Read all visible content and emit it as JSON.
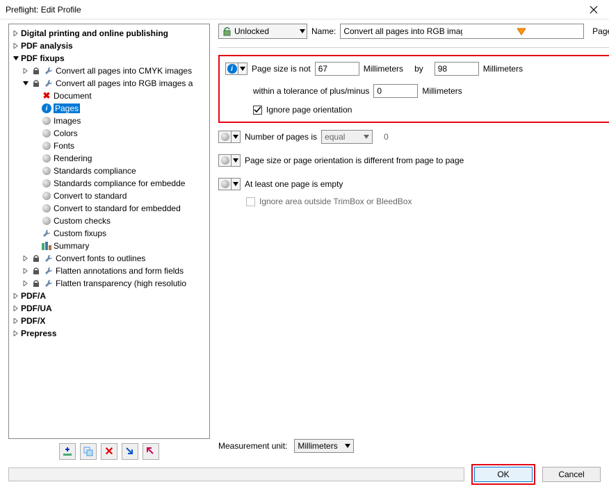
{
  "title": "Preflight: Edit Profile",
  "tree": {
    "top": [
      "Digital printing and online publishing",
      "PDF analysis",
      "PDF fixups"
    ],
    "fixups": {
      "cmyk": "Convert all pages into CMYK images",
      "rgb": "Convert all pages into RGB images a",
      "children": [
        "Document",
        "Pages",
        "Images",
        "Colors",
        "Fonts",
        "Rendering",
        "Standards compliance",
        "Standards compliance for embedde",
        "Convert to standard",
        "Convert to standard for embedded",
        "Custom checks",
        "Custom fixups",
        "Summary"
      ],
      "after": [
        "Convert fonts to outlines",
        "Flatten annotations and form fields",
        "Flatten transparency (high resolutio"
      ]
    },
    "bottom": [
      "PDF/A",
      "PDF/UA",
      "PDF/X",
      "Prepress"
    ]
  },
  "top": {
    "unlocked": "Unlocked",
    "name_label": "Name:",
    "name_value": "Convert all pages into RGB images and preserve text informa",
    "pages_label": "Pages"
  },
  "s1": {
    "label1": "Page size is not",
    "val1": "67",
    "unit": "Millimeters",
    "by": "by",
    "val2": "98",
    "tol_label": "within a tolerance of plus/minus",
    "tol_val": "0",
    "ignore": "Ignore page orientation"
  },
  "s2": {
    "label": "Number of pages is",
    "op": "equal",
    "val": "0"
  },
  "s3": {
    "label": "Page size or page orientation is different from page to page"
  },
  "s4": {
    "label": "At least one page is empty",
    "sub": "Ignore area outside TrimBox or BleedBox"
  },
  "measure": {
    "label": "Measurement unit:",
    "value": "Millimeters"
  },
  "buttons": {
    "ok": "OK",
    "cancel": "Cancel"
  }
}
